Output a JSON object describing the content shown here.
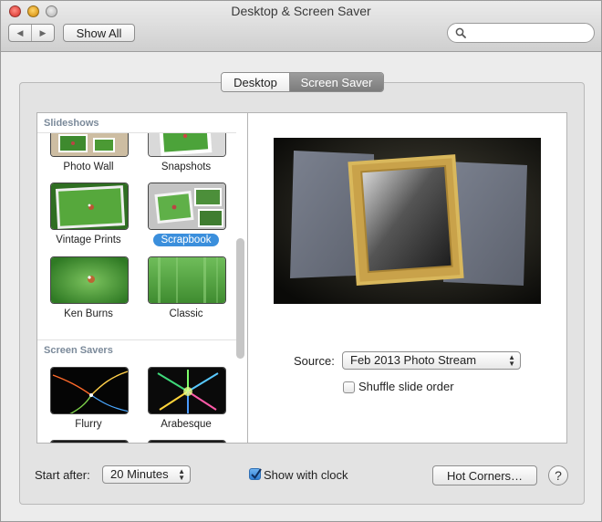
{
  "window": {
    "title": "Desktop & Screen Saver"
  },
  "toolbar": {
    "show_all_label": "Show All",
    "search_placeholder": ""
  },
  "tabs": [
    {
      "label": "Desktop",
      "selected": false
    },
    {
      "label": "Screen Saver",
      "selected": true
    }
  ],
  "sidebar": {
    "slideshows_header": "Slideshows",
    "screensavers_header": "Screen Savers",
    "items": [
      {
        "label": "Photo Wall",
        "icon": "photo-wall-thumbnail"
      },
      {
        "label": "Snapshots",
        "icon": "snapshots-thumbnail"
      },
      {
        "label": "Vintage Prints",
        "icon": "vintage-prints-thumbnail"
      },
      {
        "label": "Scrapbook",
        "icon": "scrapbook-thumbnail",
        "selected": true
      },
      {
        "label": "Ken Burns",
        "icon": "ken-burns-thumbnail"
      },
      {
        "label": "Classic",
        "icon": "classic-thumbnail"
      },
      {
        "label": "Flurry",
        "icon": "flurry-thumbnail"
      },
      {
        "label": "Arabesque",
        "icon": "arabesque-thumbnail"
      }
    ]
  },
  "options": {
    "source_label": "Source:",
    "source_value": "Feb 2013 Photo Stream",
    "shuffle_label": "Shuffle slide order",
    "shuffle_checked": false
  },
  "footer": {
    "start_after_label": "Start after:",
    "start_after_value": "20 Minutes",
    "show_clock_label": "Show with clock",
    "show_clock_checked": true,
    "hot_corners_label": "Hot Corners…",
    "help_label": "?"
  },
  "colors": {
    "selection_blue": "#3b8fdc",
    "tab_selected": "#8a8a8a",
    "section_header": "#7b8a9a"
  }
}
